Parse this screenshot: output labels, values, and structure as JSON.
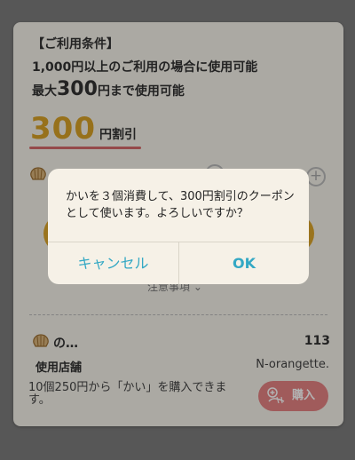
{
  "coupon": {
    "conditions_title": "【ご利用条件】",
    "condition_1": "1,000円以上のご利用の場合に使用可能",
    "condition_2_prefix": "最大",
    "condition_2_amount": "300",
    "condition_2_suffix": "円まで使用可能",
    "discount_amount": "300",
    "discount_unit": "円割引",
    "notes_label": "注意事項 ⌄"
  },
  "item": {
    "name": "の…",
    "count": "113",
    "store_label": "使用店舗",
    "store_name": "N-orangette.",
    "purchase_text": "10個250円から「かい」を購入できます。",
    "buy_label": "購入"
  },
  "dialog": {
    "message": "かいを３個消費して、300円割引のクーポンとして使います。よろしいですか？",
    "cancel_label": "キャンセル",
    "ok_label": "OK"
  },
  "colors": {
    "accent_gold": "#dda62c",
    "discount_gold": "#d9a227",
    "underline_red": "#d66a6a",
    "buy_pink": "#e58383",
    "dialog_link": "#33a8c4"
  }
}
